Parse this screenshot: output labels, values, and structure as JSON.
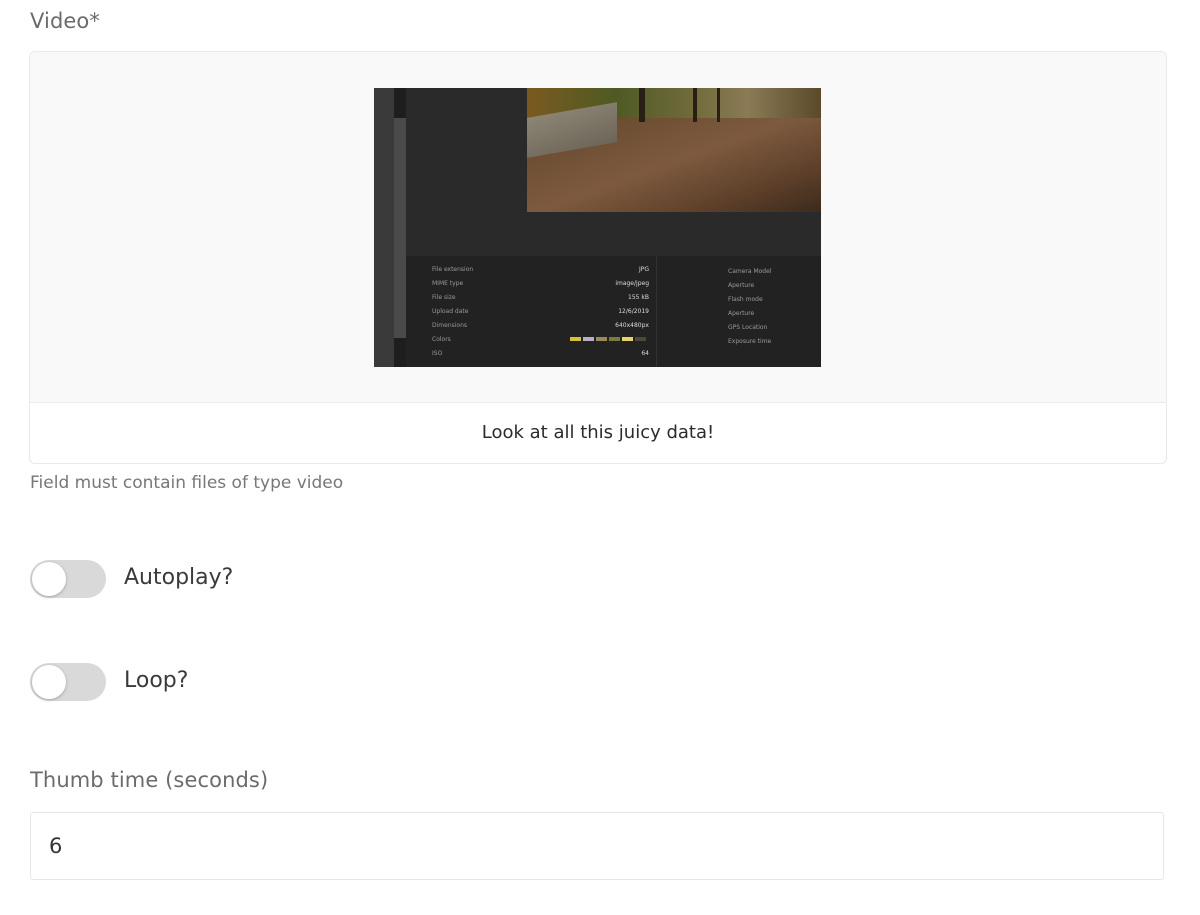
{
  "video_field": {
    "label": "Video*",
    "caption": "Look at all this juicy data!",
    "help_text": "Field must contain files of type video",
    "thumbnail_meta": {
      "rows": [
        {
          "label": "File extension",
          "value": "JPG"
        },
        {
          "label": "MIME type",
          "value": "image/jpeg"
        },
        {
          "label": "File size",
          "value": "155 kB"
        },
        {
          "label": "Upload date",
          "value": "12/6/2019"
        },
        {
          "label": "Dimensions",
          "value": "640x480px"
        },
        {
          "label": "Colors",
          "value": ""
        },
        {
          "label": "ISO",
          "value": "64"
        }
      ],
      "right_rows": [
        "Camera Model",
        "Aperture",
        "Flash mode",
        "Aperture",
        "GPS Location",
        "Exposure time"
      ],
      "swatch_colors": [
        "#d6c23a",
        "#b7b0c7",
        "#9a8a5a",
        "#7a7a3a",
        "#e6d36a",
        "#4a4a3a"
      ]
    }
  },
  "autoplay": {
    "label": "Autoplay?",
    "checked": false
  },
  "loop": {
    "label": "Loop?",
    "checked": false
  },
  "thumb_time": {
    "label": "Thumb time (seconds)",
    "value": "6"
  }
}
